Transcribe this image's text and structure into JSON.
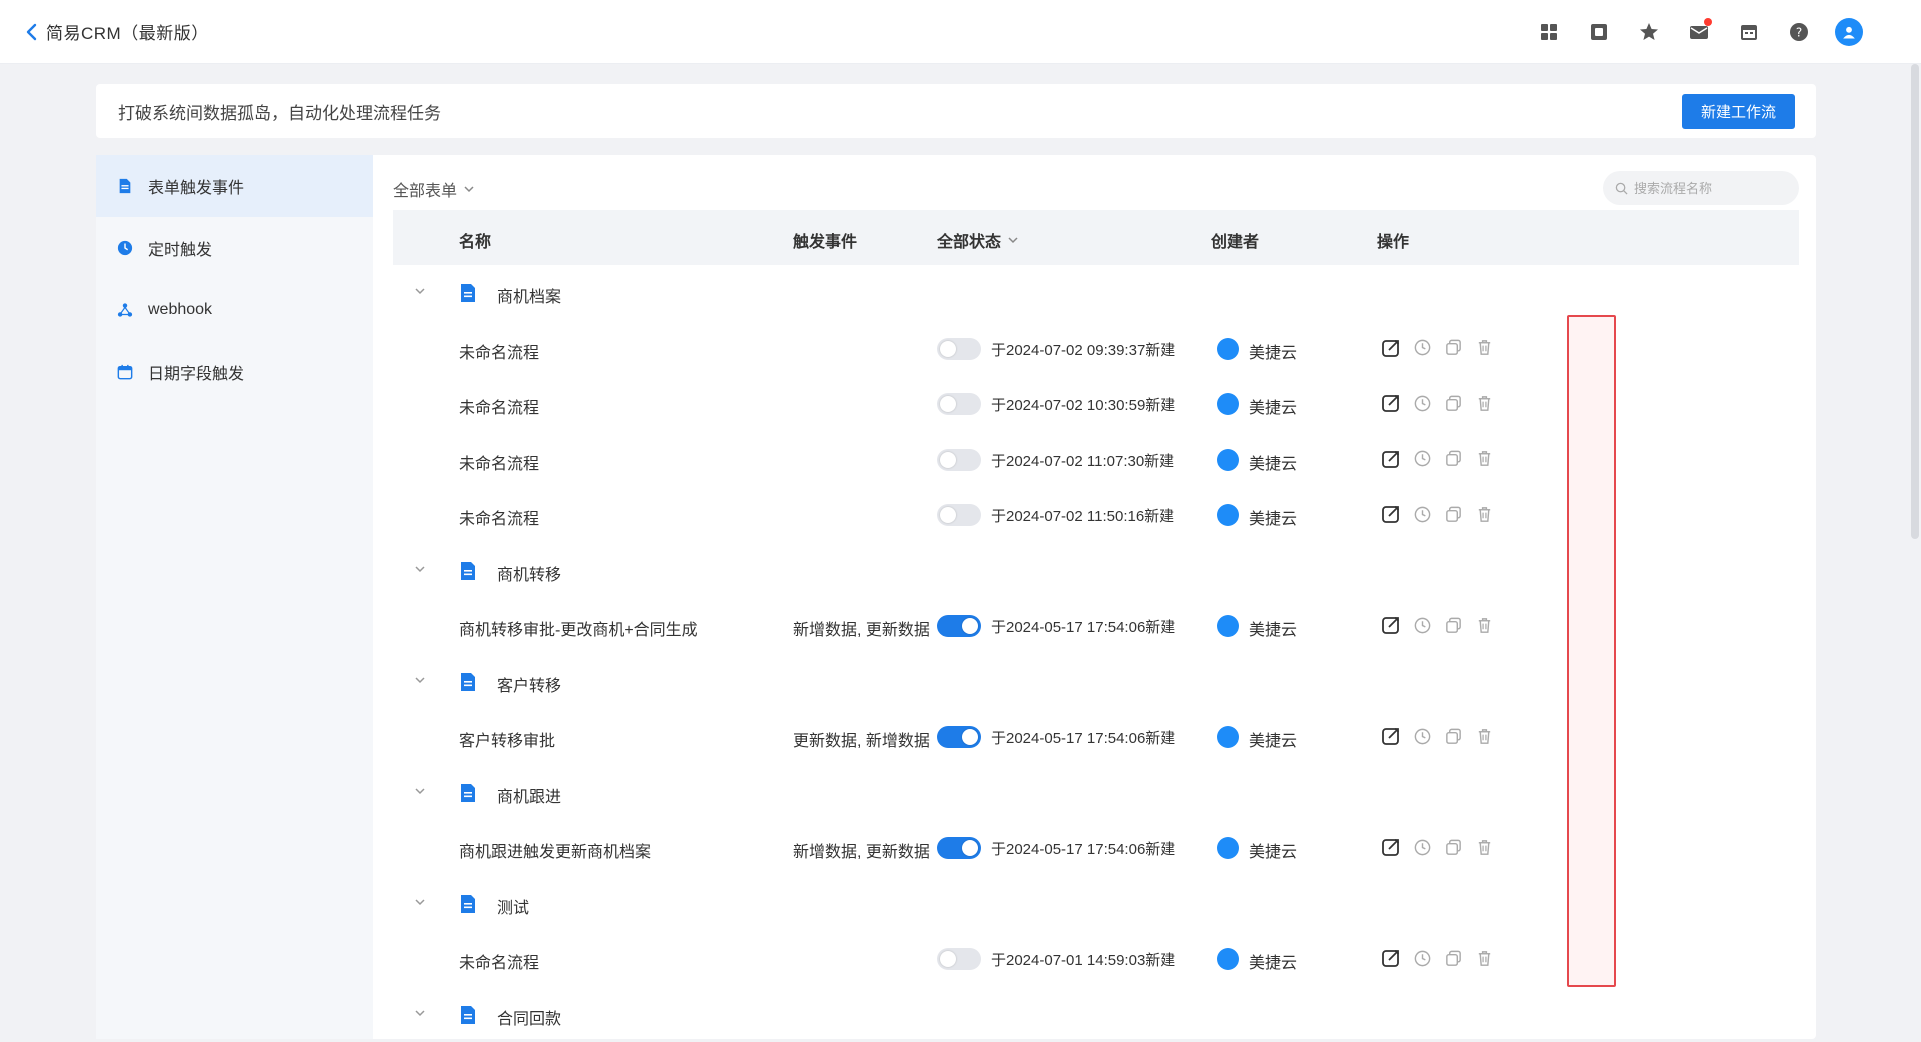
{
  "topbar": {
    "title": "简易CRM（最新版）",
    "icons": [
      "grid-icon",
      "box-icon",
      "star-icon",
      "mail-icon",
      "calendar-icon",
      "help-icon",
      "avatar"
    ]
  },
  "banner": {
    "text": "打破系统间数据孤岛，自动化处理流程任务",
    "new_button": "新建工作流"
  },
  "sidebar": {
    "items": [
      {
        "label": "表单触发事件",
        "icon": "file-icon",
        "active": true
      },
      {
        "label": "定时触发",
        "icon": "clock-icon",
        "active": false
      },
      {
        "label": "webhook",
        "icon": "webhook-icon",
        "active": false
      },
      {
        "label": "日期字段触发",
        "icon": "calendar-icon",
        "active": false
      }
    ]
  },
  "main": {
    "filter_label": "全部表单",
    "search_placeholder": "搜索流程名称",
    "columns": {
      "name": "名称",
      "trigger": "触发事件",
      "status": "全部状态",
      "creator": "创建者",
      "ops": "操作"
    }
  },
  "groups": [
    {
      "name": "商机档案",
      "flows": [
        {
          "name": "未命名流程",
          "trigger": "",
          "on": false,
          "created": "于2024-07-02 09:39:37新建",
          "creator": "美捷云"
        },
        {
          "name": "未命名流程",
          "trigger": "",
          "on": false,
          "created": "于2024-07-02 10:30:59新建",
          "creator": "美捷云"
        },
        {
          "name": "未命名流程",
          "trigger": "",
          "on": false,
          "created": "于2024-07-02 11:07:30新建",
          "creator": "美捷云"
        },
        {
          "name": "未命名流程",
          "trigger": "",
          "on": false,
          "created": "于2024-07-02 11:50:16新建",
          "creator": "美捷云"
        }
      ]
    },
    {
      "name": "商机转移",
      "flows": [
        {
          "name": "商机转移审批-更改商机+合同生成",
          "trigger": "新增数据, 更新数据",
          "on": true,
          "created": "于2024-05-17 17:54:06新建",
          "creator": "美捷云"
        }
      ]
    },
    {
      "name": "客户转移",
      "flows": [
        {
          "name": "客户转移审批",
          "trigger": "更新数据, 新增数据",
          "on": true,
          "created": "于2024-05-17 17:54:06新建",
          "creator": "美捷云"
        }
      ]
    },
    {
      "name": "商机跟进",
      "flows": [
        {
          "name": "商机跟进触发更新商机档案",
          "trigger": "新增数据, 更新数据",
          "on": true,
          "created": "于2024-05-17 17:54:06新建",
          "creator": "美捷云"
        }
      ]
    },
    {
      "name": "测试",
      "flows": [
        {
          "name": "未命名流程",
          "trigger": "",
          "on": false,
          "created": "于2024-07-01 14:59:03新建",
          "creator": "美捷云"
        }
      ]
    },
    {
      "name": "合同回款",
      "flows": []
    }
  ],
  "colors": {
    "accent": "#1e7ce8",
    "highlight_border": "#e5484d"
  }
}
